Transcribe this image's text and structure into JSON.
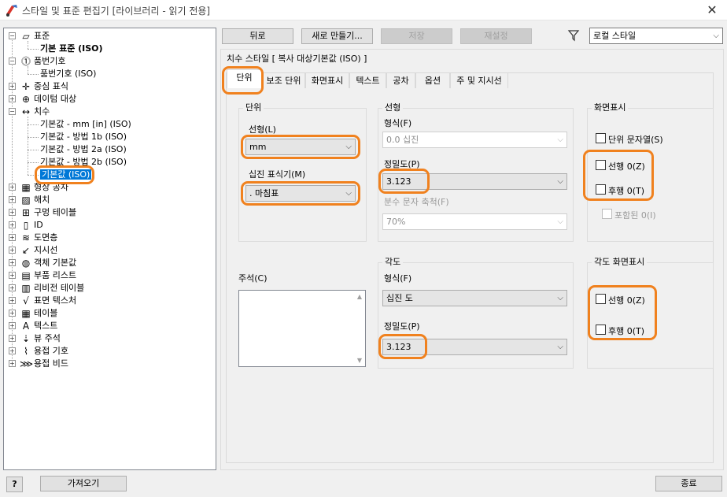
{
  "window": {
    "title": "스타일 및 표준 편집기 [라이브러리 - 읽기 전용]",
    "close_glyph": "✕"
  },
  "tree": {
    "items": [
      {
        "label": "표준",
        "icon": "standard-icon"
      },
      {
        "label": "기본 표준 (ISO)",
        "bold": true
      },
      {
        "label": "품번기호",
        "icon": "balloon-icon"
      },
      {
        "label": "품번기호 (ISO)"
      },
      {
        "label": "중심 표식",
        "icon": "center-mark-icon"
      },
      {
        "label": "데이텀 대상",
        "icon": "datum-target-icon"
      },
      {
        "label": "치수",
        "icon": "dimension-icon"
      },
      {
        "label": "기본값 - mm [in] (ISO)"
      },
      {
        "label": "기본값 - 방법 1b (ISO)"
      },
      {
        "label": "기본값 - 방법 2a (ISO)"
      },
      {
        "label": "기본값 - 방법 2b (ISO)"
      },
      {
        "label": "기본값 (ISO)",
        "selected": true
      },
      {
        "label": "형상 공차",
        "icon": "feature-control-icon"
      },
      {
        "label": "해치",
        "icon": "hatch-icon"
      },
      {
        "label": "구멍 테이블",
        "icon": "hole-table-icon"
      },
      {
        "label": "ID",
        "icon": "id-icon"
      },
      {
        "label": "도면층",
        "icon": "layer-icon"
      },
      {
        "label": "지시선",
        "icon": "leader-icon"
      },
      {
        "label": "객체 기본값",
        "icon": "object-defaults-icon"
      },
      {
        "label": "부품 리스트",
        "icon": "parts-list-icon"
      },
      {
        "label": "리비전 테이블",
        "icon": "revision-table-icon"
      },
      {
        "label": "표면 텍스처",
        "icon": "surface-texture-icon"
      },
      {
        "label": "테이블",
        "icon": "table-icon"
      },
      {
        "label": "텍스트",
        "icon": "text-icon"
      },
      {
        "label": "뷰 주석",
        "icon": "view-annotation-icon"
      },
      {
        "label": "용접 기호",
        "icon": "weld-symbol-icon"
      },
      {
        "label": "용접 비드",
        "icon": "weld-bead-icon"
      }
    ]
  },
  "toolbar": {
    "back": "뒤로",
    "new": "새로 만들기...",
    "save": "저장",
    "reset": "재설정",
    "filter_icon": "filter-icon",
    "filter_value": "로컬 스타일"
  },
  "style_header": "치수 스타일 [ 복사 대상기본값 (ISO) ]",
  "tabs": [
    "단위",
    "보조 단위",
    "화면표시",
    "텍스트",
    "공차",
    "옵션",
    "주 및 지시선"
  ],
  "units": {
    "group": "단위",
    "linear_label": "선형(L)",
    "linear_value": "mm",
    "decimal_label": "십진 표식기(M)",
    "decimal_value": ". 마침표"
  },
  "linear": {
    "group": "선형",
    "format_label": "형식(F)",
    "format_value": "0.0 십진",
    "precision_label": "정밀도(P)",
    "precision_value": "3.123",
    "fraction_label": "분수 문자 축척(F)",
    "fraction_value": "70%"
  },
  "display": {
    "group": "화면표시",
    "unit_string": "단위 문자열(S)",
    "leading": "선행 0(Z)",
    "trailing": "후행 0(T)",
    "inclusive": "포함된 0(I)"
  },
  "comment_label": "주석(C)",
  "angle": {
    "group": "각도",
    "format_label": "형식(F)",
    "format_value": "십진 도",
    "precision_label": "정밀도(P)",
    "precision_value": "3.123"
  },
  "angle_display": {
    "group": "각도 화면표시",
    "leading": "선행 0(Z)",
    "trailing": "후행 0(T)"
  },
  "bottom": {
    "help": "?",
    "import": "가져오기",
    "close": "종료"
  },
  "colors": {
    "highlight": "#f0811e",
    "selection": "#0078d7"
  }
}
